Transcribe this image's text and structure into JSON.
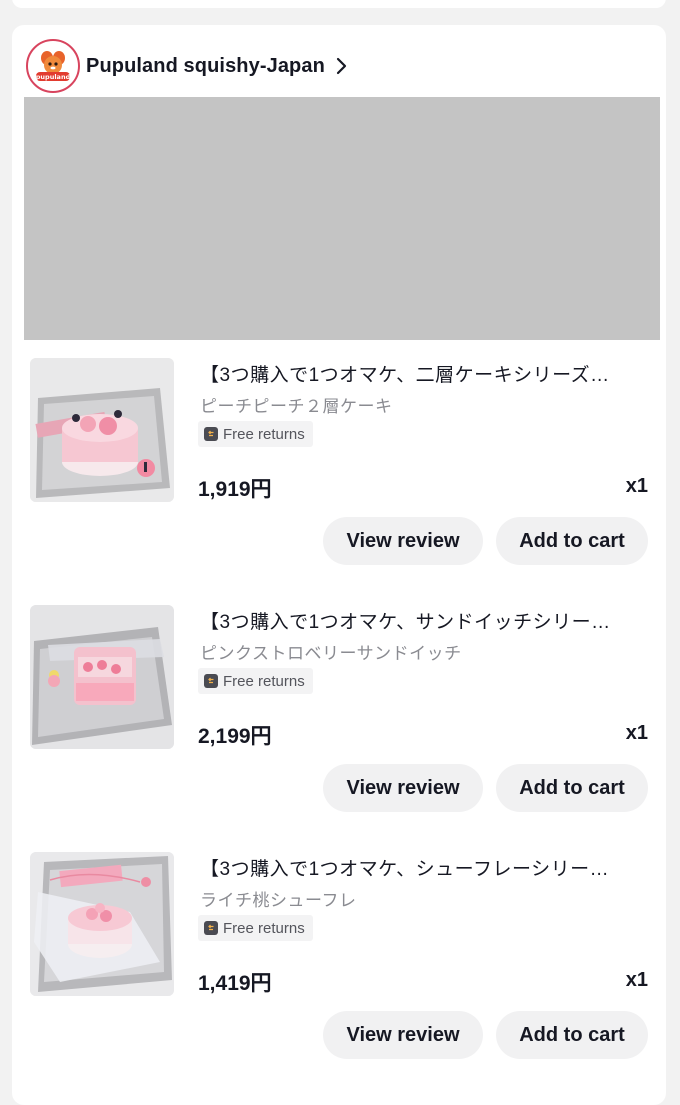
{
  "store": {
    "name": "Pupuland squishy-Japan",
    "logo_text": "pupuland"
  },
  "items": [
    {
      "title": "【3つ購入で1つオマケ、二層ケーキシリーズ…",
      "variant": "ピーチピーチ２層ケーキ",
      "badge": "Free returns",
      "price": "1,919円",
      "qty": "x1",
      "review_label": "View review",
      "cart_label": "Add to cart"
    },
    {
      "title": "【3つ購入で1つオマケ、サンドイッチシリー…",
      "variant": "ピンクストロベリーサンドイッチ",
      "badge": "Free returns",
      "price": "2,199円",
      "qty": "x1",
      "review_label": "View review",
      "cart_label": "Add to cart"
    },
    {
      "title": "【3つ購入で1つオマケ、シューフレーシリー…",
      "variant": "ライチ桃シューフレ",
      "badge": "Free returns",
      "price": "1,419円",
      "qty": "x1",
      "review_label": "View review",
      "cart_label": "Add to cart"
    }
  ],
  "colors": {
    "page_bg": "#f2f2f2",
    "card_bg": "#ffffff",
    "button_bg": "#f1f1f2",
    "banner_bg": "#c4c4c4",
    "logo_border": "#d8445e"
  }
}
